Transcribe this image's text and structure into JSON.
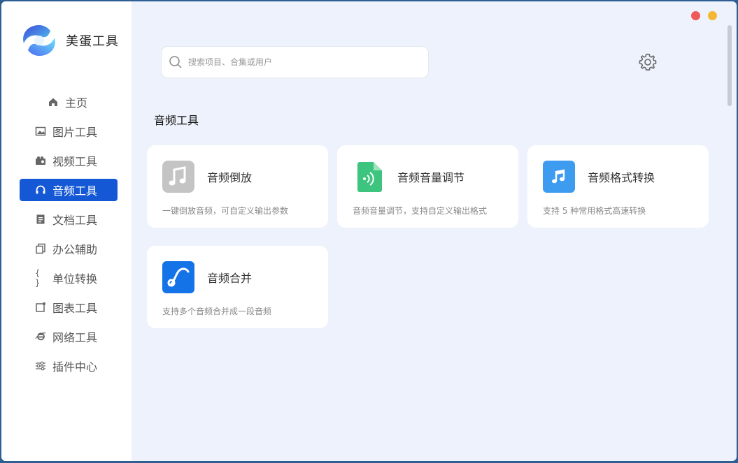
{
  "app": {
    "name": "美蛋工具"
  },
  "sidebar": {
    "items": [
      {
        "label": "主页",
        "icon": "home-icon"
      },
      {
        "label": "图片工具",
        "icon": "image-icon"
      },
      {
        "label": "视频工具",
        "icon": "video-icon"
      },
      {
        "label": "音频工具",
        "icon": "headphones-icon",
        "active": true
      },
      {
        "label": "文档工具",
        "icon": "document-icon"
      },
      {
        "label": "办公辅助",
        "icon": "copy-icon"
      },
      {
        "label": "单位转换",
        "icon": "braces-icon",
        "glyph": "{ }"
      },
      {
        "label": "图表工具",
        "icon": "chart-icon"
      },
      {
        "label": "网络工具",
        "icon": "browser-icon"
      },
      {
        "label": "插件中心",
        "icon": "sliders-icon"
      }
    ]
  },
  "search": {
    "placeholder": "搜索项目、合集或用户",
    "value": ""
  },
  "section": {
    "title": "音频工具"
  },
  "cards": [
    {
      "title": "音频倒放",
      "desc": "一键倒放音频，可自定义输出参数",
      "icon": "music-note-icon",
      "color": "#c4c4c4"
    },
    {
      "title": "音频音量调节",
      "desc": "音频音量调节，支持自定义输出格式",
      "icon": "audio-file-icon",
      "color": "#3dc47e"
    },
    {
      "title": "音频格式转换",
      "desc": "支持 5 种常用格式高速转换",
      "icon": "music-convert-icon",
      "color": "#3d9bf0"
    },
    {
      "title": "音频合并",
      "desc": "支持多个音频合并成一段音频",
      "icon": "wave-icon",
      "color": "#1573e8"
    }
  ],
  "colors": {
    "accent": "#1458d6",
    "background": "#eef2fc",
    "close": "#ee5a5a",
    "minimize": "#f4b733"
  }
}
